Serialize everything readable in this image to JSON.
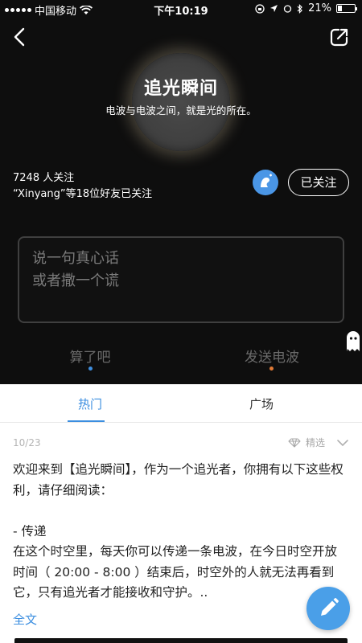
{
  "status_bar": {
    "carrier": "中国移动",
    "time": "下午10:19",
    "battery": "21%",
    "battery_level": 0.21
  },
  "topic": {
    "title": "追光瞬间",
    "subtitle": "电波与电波之间，就是光的所在。",
    "followers_text": "7248 人关注",
    "friends_text": "“Xinyang”等18位好友已关注",
    "follow_button": "已关注"
  },
  "composer": {
    "placeholder_line1": "说一句真心话",
    "placeholder_line2": "或者撒一个谎",
    "cancel_label": "算了吧",
    "send_label": "发送电波"
  },
  "tabs": [
    {
      "label": "热门",
      "active": true
    },
    {
      "label": "广场",
      "active": false
    }
  ],
  "post": {
    "date": "10/23",
    "tag": "精选",
    "paragraph1": "欢迎来到【追光瞬间】，作为一个追光者，你拥有以下这些权利，请仔细阅读：",
    "paragraph2": "- 传递",
    "paragraph3": "在这个时空里，每天你可以传递一条电波，在今日时空开放时间（ 20:00 - 8:00 ）结束后，时空外的人就无法再看到它，只有追光者才能接收和守护。..",
    "read_more": "全文"
  },
  "colors": {
    "accent": "#3b8ee0",
    "fab": "#4a9fe8",
    "dark_bg": "#0e0e0e",
    "orange_dot": "#e07a36"
  },
  "icons": [
    "back-icon",
    "share-icon",
    "wifi-icon",
    "location-icon",
    "bluetooth-icon",
    "avatar-icon",
    "ghost-icon",
    "diamond-icon",
    "chevron-down-icon",
    "pencil-icon"
  ]
}
